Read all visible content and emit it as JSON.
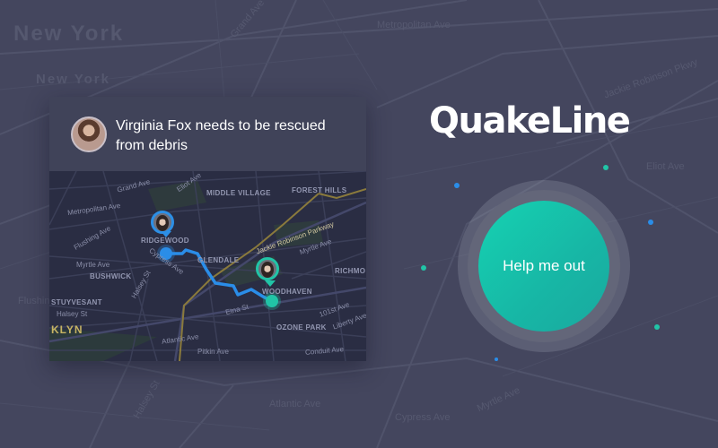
{
  "background": {
    "city_labels": [
      "New York",
      "New York"
    ],
    "street_labels": [
      "Metropolitan Ave",
      "Jackie Robinson Pkwy",
      "Myrtle Ave",
      "Halsey St",
      "Flushing Ave",
      "Grand Ave",
      "Eliot Ave",
      "Cypress Ave",
      "Atlantic Ave"
    ]
  },
  "card": {
    "message": "Virginia Fox needs to be rescued from debris",
    "avatar_icon": "woman-avatar",
    "map": {
      "labels": {
        "grand_ave": "Grand Ave",
        "eliot_ave": "Eliot Ave",
        "middle_village": "MIDDLE VILLAGE",
        "forest_hills": "FOREST HILLS",
        "metropolitan_ave": "Metropolitan Ave",
        "flushing_ave": "Flushing Ave",
        "ridgewood": "RIDGEWOOD",
        "cypress_ave": "Cypress Ave",
        "jackie_robinson_pkwy": "Jackie Robinson Parkway",
        "myrtle_ave": "Myrtle Ave",
        "glendale": "GLENDALE",
        "bushwick": "BUSHWICK",
        "richmond": "RICHMO",
        "halsey_st_1": "Halsey St",
        "stuyvesant": "STUYVESANT",
        "halsey_st_2": "Halsey St",
        "woodhaven": "WOODHAVEN",
        "etna_st": "Etna St",
        "st_101": "101st Ave",
        "liberty_ave": "Liberty Ave",
        "klyn": "KLYN",
        "atlantic_ave": "Atlantic Ave",
        "ozone_park": "OZONE PARK",
        "pitkin_ave": "Pitkin Ave",
        "conduit_ave": "Conduit Ave"
      },
      "route_color": "#2a8de8",
      "destination_color": "#21c4a7"
    }
  },
  "app": {
    "logo": "QuakeLine",
    "help_button_label": "Help me out",
    "accent_color": "#17c2a8"
  }
}
